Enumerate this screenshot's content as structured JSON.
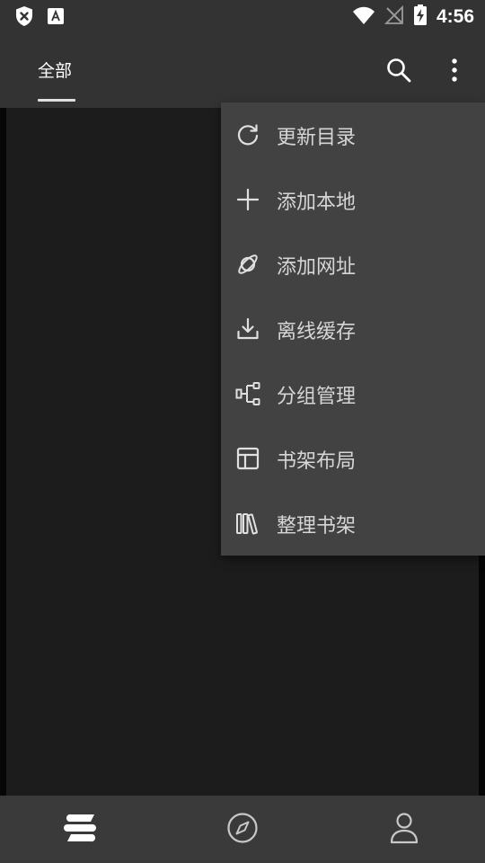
{
  "status_bar": {
    "time": "4:56",
    "icons": [
      "shield-x-icon",
      "font-a-icon",
      "wifi-icon",
      "no-signal-icon",
      "battery-charging-icon"
    ]
  },
  "top_bar": {
    "tab_label": "全部",
    "search_icon": "search-icon",
    "more_icon": "more-vert-icon"
  },
  "menu": {
    "items": [
      {
        "label": "更新目录",
        "icon": "refresh-icon"
      },
      {
        "label": "添加本地",
        "icon": "plus-icon"
      },
      {
        "label": "添加网址",
        "icon": "planet-icon"
      },
      {
        "label": "离线缓存",
        "icon": "download-icon"
      },
      {
        "label": "分组管理",
        "icon": "group-tree-icon"
      },
      {
        "label": "书架布局",
        "icon": "layout-icon"
      },
      {
        "label": "整理书架",
        "icon": "books-icon"
      }
    ]
  },
  "bottom_nav": {
    "items": [
      {
        "icon": "bookshelf-icon",
        "active": true
      },
      {
        "icon": "compass-icon",
        "active": false
      },
      {
        "icon": "person-icon",
        "active": false
      }
    ]
  },
  "colors": {
    "bar_bg": "#333333",
    "content_bg": "#1c1c1c",
    "menu_bg": "#424242",
    "bottom_nav_bg": "#3a3a3a",
    "text": "#d6d6d6"
  }
}
